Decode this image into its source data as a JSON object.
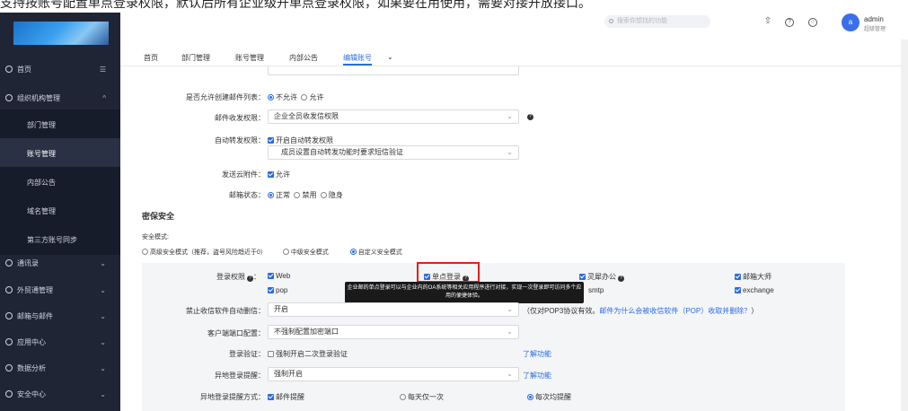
{
  "caption": "支持按账号配置单点登录权限，默认后所有企业级开单点登录权限，如果要在用使用，需要对接开放接口。",
  "colors": {
    "accent": "#2a6de0",
    "sidebar_bg": "#1f2535",
    "highlight": "#e0201c"
  },
  "topbar": {
    "search_placeholder": "搜索你想找的功能",
    "user_initial": "a",
    "user_name": "admin",
    "user_role": "超级管理",
    "icons": [
      "upload-icon",
      "help-icon",
      "theme-icon"
    ]
  },
  "sidebar": {
    "items": [
      {
        "label": "首页",
        "icon": "home-icon",
        "arrow": "☰"
      },
      {
        "label": "组织机构管理",
        "icon": "org-icon",
        "arrow": "^"
      },
      {
        "label": "通讯录",
        "icon": "contacts-icon",
        "arrow": "⌄"
      },
      {
        "label": "外贸通管理",
        "icon": "trade-icon",
        "arrow": "⌄"
      },
      {
        "label": "邮箱与邮件",
        "icon": "mail-icon",
        "arrow": "⌄"
      },
      {
        "label": "应用中心",
        "icon": "apps-icon",
        "arrow": "⌄"
      },
      {
        "label": "数据分析",
        "icon": "chart-icon",
        "arrow": "⌄"
      },
      {
        "label": "安全中心",
        "icon": "security-icon",
        "arrow": "⌄"
      }
    ],
    "subitems": [
      "部门管理",
      "账号管理",
      "内部公告",
      "域名管理",
      "第三方账号同步"
    ]
  },
  "nav": {
    "tabs": [
      "首页",
      "部门管理",
      "账号管理",
      "内部公告",
      "编辑账号"
    ],
    "more": "⌄"
  },
  "form": {
    "create_list_label": "是否允许创建邮件列表：",
    "create_list_opt1": "不允许",
    "create_list_opt2": "允许",
    "send_perm_label": "邮件收发权限：",
    "send_perm_value": "企业全员收发信权限",
    "forward_label": "自动转发权限：",
    "forward_check": "开启自动转发权限",
    "forward_value": "成员设置自动转发功能时要求短信验证",
    "cloud_label": "发送云附件：",
    "cloud_check": "允许",
    "status_label": "邮箱状态：",
    "status_opt1": "正常",
    "status_opt2": "禁用",
    "status_opt3": "隐身"
  },
  "security": {
    "title": "密保安全",
    "mode_label": "安全模式:",
    "mode_opt1": "高级安全模式（推荐，盗号风险趋近于0）",
    "mode_opt2": "中级安全模式",
    "mode_opt3": "自定义安全模式",
    "login_perm_label": "登录权限",
    "perm_web": "Web",
    "perm_sso": "单点登录",
    "perm_office": "灵犀办公",
    "perm_master": "邮箱大师",
    "perm_pop": "pop",
    "perm_smtp": "smtp",
    "perm_exchange": "exchange",
    "tooltip": "企业邮的单点登录可以与企业内的OA系统等相关应用程序进行对接，实现一次登录即可访问多个应用的便捷体验。",
    "forbid_label": "禁止收信软件自动删信：",
    "forbid_value": "开启",
    "forbid_note": "（仅对POP3协议有效。",
    "forbid_link": "邮件为什么会被收信软件（POP）收取并删除？",
    "forbid_note_end": "）",
    "client_label": "客户端端口配置：",
    "client_value": "不强制配置加密端口",
    "verify_label": "登录验证：",
    "verify_check": "强制开启二次登录验证",
    "verify_link": "了解功能",
    "remote_label": "异地登录提醒：",
    "remote_value": "强制开启",
    "remote_link": "了解功能",
    "remote_way_label": "异地登录提醒方式：",
    "remote_way_check": "邮件提醒",
    "remote_way_opt1": "每天仅一次",
    "remote_way_opt2": "每次均提醒"
  }
}
